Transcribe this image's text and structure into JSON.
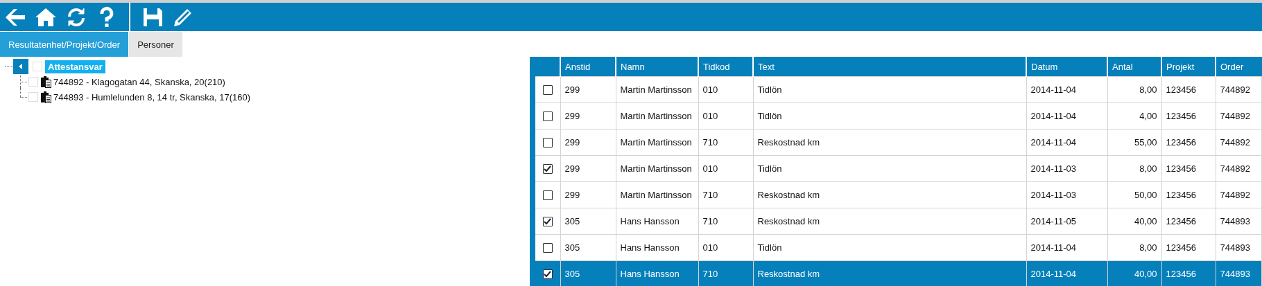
{
  "toolbar": {
    "buttons": [
      {
        "kind": "back"
      },
      {
        "kind": "home"
      },
      {
        "kind": "refresh"
      },
      {
        "kind": "help"
      },
      {
        "kind": "save"
      },
      {
        "kind": "edit"
      }
    ]
  },
  "tabs": [
    {
      "label": "Resultatenhet/Projekt/Order",
      "selected": true
    },
    {
      "label": "Personer",
      "selected": false
    }
  ],
  "tree": {
    "label": "Attestansvar",
    "expanded": true,
    "checked": false,
    "selected": true,
    "children": [
      {
        "label": "744892 - Klagogatan 44, Skanska, 20(210)",
        "checked": false
      },
      {
        "label": "744893 - Humlelunden 8, 14 tr, Skanska, 17(160)",
        "checked": false
      }
    ]
  },
  "table": {
    "columns": [
      {
        "label": "Anstid",
        "kind": "text"
      },
      {
        "label": "Namn",
        "kind": "text"
      },
      {
        "label": "Tidkod",
        "kind": "text"
      },
      {
        "label": "Text",
        "kind": "text"
      },
      {
        "label": "Datum",
        "kind": "text"
      },
      {
        "label": "Antal",
        "kind": "number"
      },
      {
        "label": "Projekt",
        "kind": "text"
      },
      {
        "label": "Order",
        "kind": "text"
      }
    ],
    "rows": [
      {
        "checked": false,
        "selected": false,
        "cells": [
          "299",
          "Martin Martinsson",
          "010",
          "Tidlön",
          "2014-11-04",
          "8,00",
          "123456",
          "744892"
        ]
      },
      {
        "checked": false,
        "selected": false,
        "cells": [
          "299",
          "Martin Martinsson",
          "010",
          "Tidlön",
          "2014-11-04",
          "4,00",
          "123456",
          "744892"
        ]
      },
      {
        "checked": false,
        "selected": false,
        "cells": [
          "299",
          "Martin Martinsson",
          "710",
          "Reskostnad km",
          "2014-11-04",
          "55,00",
          "123456",
          "744892"
        ]
      },
      {
        "checked": true,
        "selected": false,
        "cells": [
          "299",
          "Martin Martinsson",
          "010",
          "Tidlön",
          "2014-11-03",
          "8,00",
          "123456",
          "744892"
        ]
      },
      {
        "checked": false,
        "selected": false,
        "cells": [
          "299",
          "Martin Martinsson",
          "710",
          "Reskostnad km",
          "2014-11-03",
          "50,00",
          "123456",
          "744892"
        ]
      },
      {
        "checked": true,
        "selected": false,
        "cells": [
          "305",
          "Hans Hansson",
          "710",
          "Reskostnad km",
          "2014-11-05",
          "40,00",
          "123456",
          "744893"
        ]
      },
      {
        "checked": false,
        "selected": false,
        "cells": [
          "305",
          "Hans Hansson",
          "010",
          "Tidlön",
          "2014-11-04",
          "8,00",
          "123456",
          "744893"
        ]
      },
      {
        "checked": true,
        "selected": true,
        "cells": [
          "305",
          "Hans Hansson",
          "710",
          "Reskostnad km",
          "2014-11-04",
          "40,00",
          "123456",
          "744893"
        ]
      }
    ]
  }
}
